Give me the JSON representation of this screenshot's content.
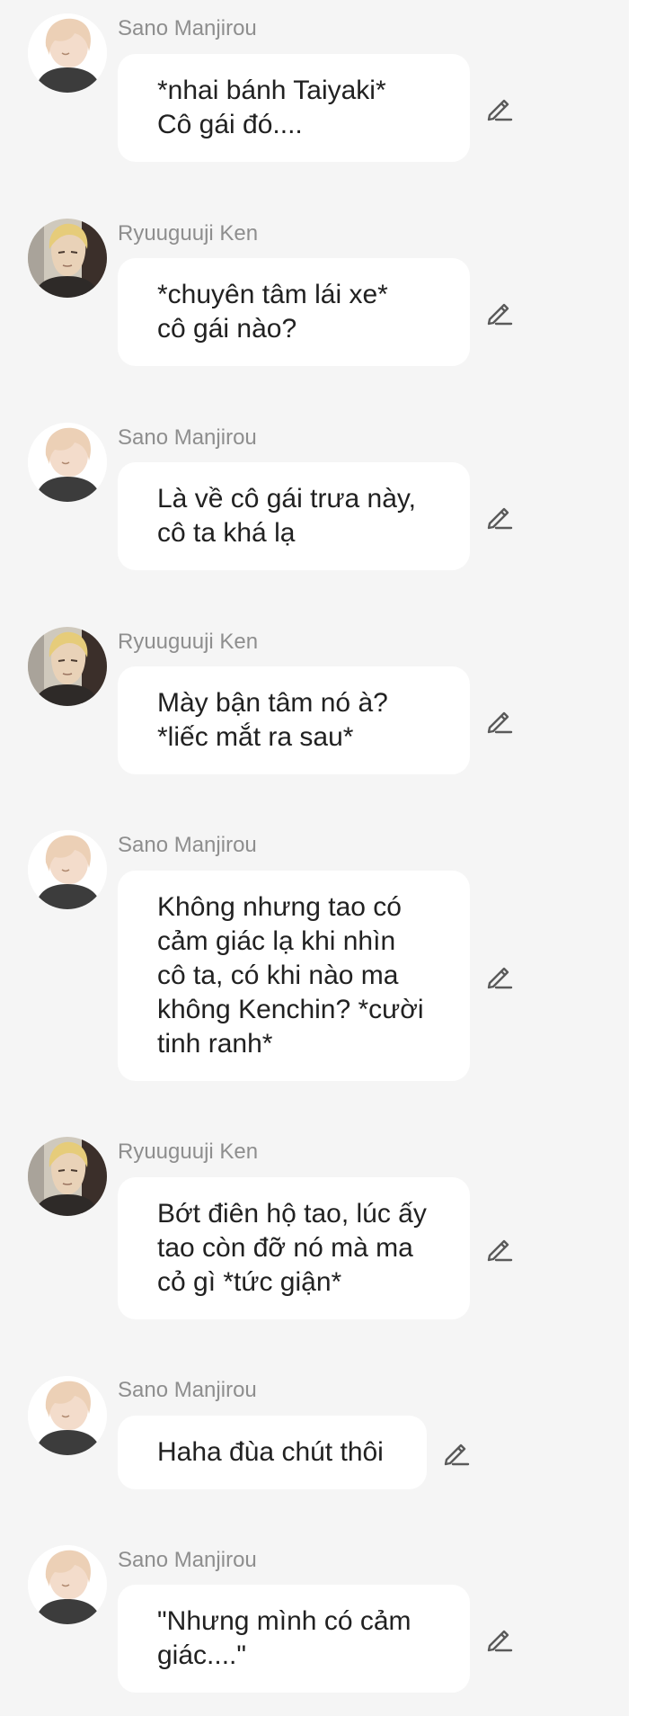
{
  "messages": [
    {
      "sender": "Sano Manjirou",
      "avatar": "sano-avatar",
      "lines": [
        "*nhai bánh Taiyaki*",
        "Cô gái đó...."
      ]
    },
    {
      "sender": "Ryuuguuji Ken",
      "avatar": "ken-avatar",
      "lines": [
        "*chuyên tâm lái xe*",
        "cô gái nào?"
      ]
    },
    {
      "sender": "Sano Manjirou",
      "avatar": "sano-avatar",
      "lines": [
        "Là về cô gái trưa này,",
        "cô ta khá lạ"
      ]
    },
    {
      "sender": "Ryuuguuji Ken",
      "avatar": "ken-avatar",
      "lines": [
        "Mày bận tâm nó à?",
        "*liếc mắt ra sau*"
      ]
    },
    {
      "sender": "Sano Manjirou",
      "avatar": "sano-avatar",
      "lines": [
        "Không nhưng tao có",
        "cảm giác lạ khi nhìn",
        "cô ta, có khi nào ma",
        "không Kenchin? *cười",
        "tinh ranh*"
      ]
    },
    {
      "sender": "Ryuuguuji Ken",
      "avatar": "ken-avatar",
      "lines": [
        "Bớt điên hộ tao, lúc ấy",
        "tao còn đỡ nó mà ma",
        "cỏ gì *tức giận*"
      ]
    },
    {
      "sender": "Sano Manjirou",
      "avatar": "sano-avatar",
      "lines": [
        "Haha đùa chút thôi"
      ]
    },
    {
      "sender": "Sano Manjirou",
      "avatar": "sano-avatar",
      "lines": [
        "\"Nhưng mình có cảm",
        "giác....\""
      ]
    }
  ],
  "icons": {
    "edit": "pencil-icon"
  },
  "colors": {
    "background": "#f5f5f5",
    "bubble": "#ffffff",
    "sender_name": "#8e8e8e",
    "text": "#212121",
    "icon": "#5a5a5a"
  }
}
